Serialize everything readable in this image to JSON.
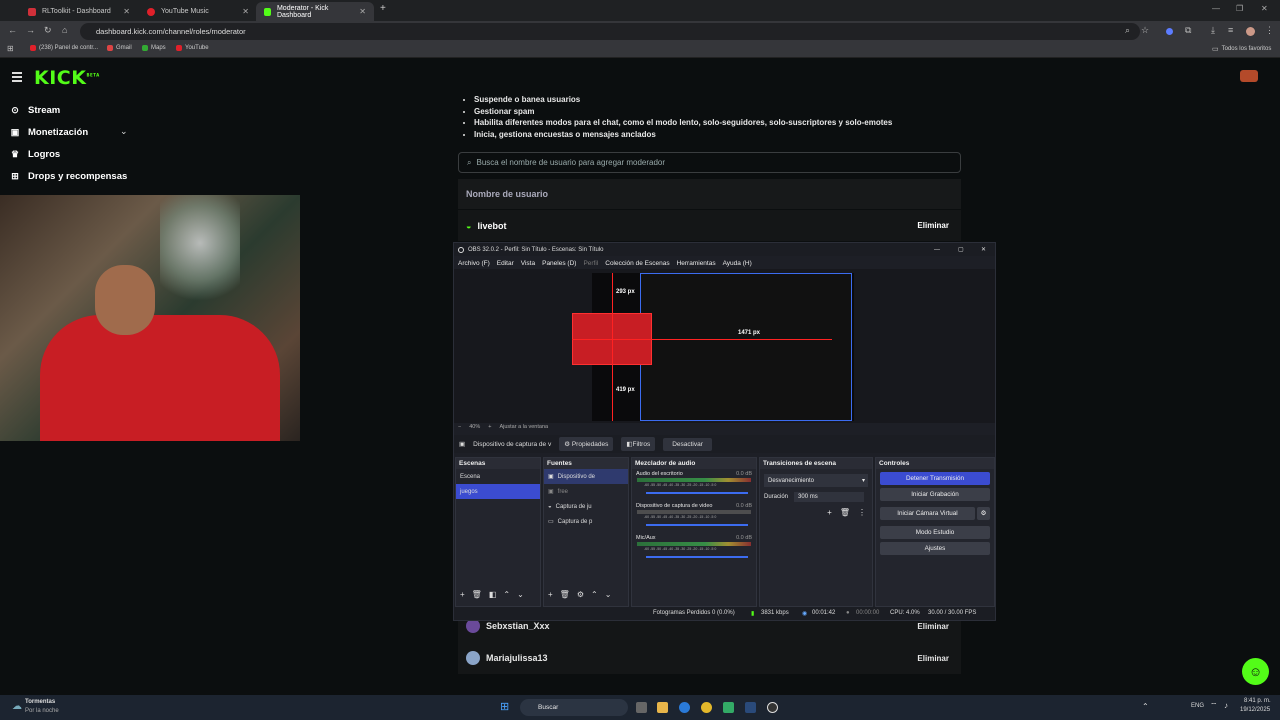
{
  "browser": {
    "tabs": [
      {
        "label": "RLToolkit - Dashboard",
        "color": "#d0303a"
      },
      {
        "label": "YouTube Music",
        "color": "#e0202a"
      },
      {
        "label": "Moderator - Kick Dashboard",
        "color": "#53fc18"
      }
    ],
    "url": "dashboard.kick.com/channel/roles/moderator",
    "bookmarks": [
      {
        "label": "(238) Panel de contr...",
        "color": "#e0202a"
      },
      {
        "label": "Gmail",
        "color": "#d44"
      },
      {
        "label": "Maps",
        "color": "#3a3"
      },
      {
        "label": "YouTube",
        "color": "#e0202a"
      }
    ],
    "all_bookmarks": "Todos los favoritos"
  },
  "kick": {
    "logo": "KICK",
    "beta": "BETA",
    "sidebar": [
      {
        "label": "Stream",
        "icon": "broadcast-icon"
      },
      {
        "label": "Monetización",
        "icon": "wallet-icon"
      },
      {
        "label": "Logros",
        "icon": "trophy-icon"
      },
      {
        "label": "Drops y recompensas",
        "icon": "gift-icon"
      }
    ],
    "permissions": [
      "Suspende o banea usuarios",
      "Gestionar spam",
      "Habilita diferentes modos para el chat, como el modo lento, solo-seguidores, solo-suscriptores y solo-emotes",
      "Inicia, gestiona encuestas o mensajes anclados"
    ],
    "search_placeholder": "Busca el nombre de usuario para agregar moderador",
    "table_header": "Nombre de usuario",
    "moderators": [
      {
        "name": "livebot",
        "action": "Eliminar"
      },
      {
        "name": "Sebxstian_Xxx",
        "action": "Eliminar"
      },
      {
        "name": "Mariajulissa13",
        "action": "Eliminar"
      }
    ]
  },
  "obs": {
    "title": "OBS 32.0.2 - Perfil: Sin Título - Escenas: Sin Título",
    "menu": [
      "Archivo (F)",
      "Editar",
      "Vista",
      "Paneles (D)",
      "Perfil",
      "Colección de Escenas",
      "Herramientas",
      "Ayuda (H)"
    ],
    "preview_labels": {
      "top": "293 px",
      "mid": "1471 px",
      "bottom": "419 px"
    },
    "zoom": "40%",
    "fit": "Ajustar a la ventana",
    "source_bar": {
      "source": "Dispositivo de captura de v",
      "properties": "Propiedades",
      "filters": "Filtros",
      "deactivate": "Desactivar"
    },
    "scenes": {
      "title": "Escenas",
      "items": [
        "Escena",
        "juegos"
      ],
      "selected": 1
    },
    "sources": {
      "title": "Fuentes",
      "items": [
        "Dispositivo de",
        "free",
        "Captura de ju",
        "Captura de p"
      ]
    },
    "mixer": {
      "title": "Mezclador de audio",
      "channels": [
        {
          "name": "Audio del escritorio",
          "db": "0.0 dB"
        },
        {
          "name": "Dispositivo de captura de video",
          "db": "0.0 dB"
        },
        {
          "name": "Mic/Aux",
          "db": "0.0 dB"
        }
      ],
      "scale": "-60 -55 -50 -45 -40 -35 -30 -25 -20 -15 -10 -5 0"
    },
    "transitions": {
      "title": "Transiciones de escena",
      "selected": "Desvanecimiento",
      "duration_label": "Duración",
      "duration": "300 ms"
    },
    "controls": {
      "title": "Controles",
      "stop_stream": "Detener Transmisión",
      "start_record": "Iniciar Grabación",
      "virtual_cam": "Iniciar Cámara Virtual",
      "studio_mode": "Modo Estudio",
      "settings": "Ajustes"
    },
    "status": {
      "dropped": "Fotogramas Perdidos 0 (0.0%)",
      "bitrate": "3831 kbps",
      "stream_time": "00:01:42",
      "rec_time": "00:00:00",
      "cpu": "CPU: 4.0%",
      "fps": "30.00 / 30.00 FPS"
    }
  },
  "taskbar": {
    "weather_title": "Tormentas",
    "weather_sub": "Por la noche",
    "search": "Buscar",
    "lang": "ENG",
    "time": "8:41 p. m.",
    "date": "19/12/2025"
  }
}
